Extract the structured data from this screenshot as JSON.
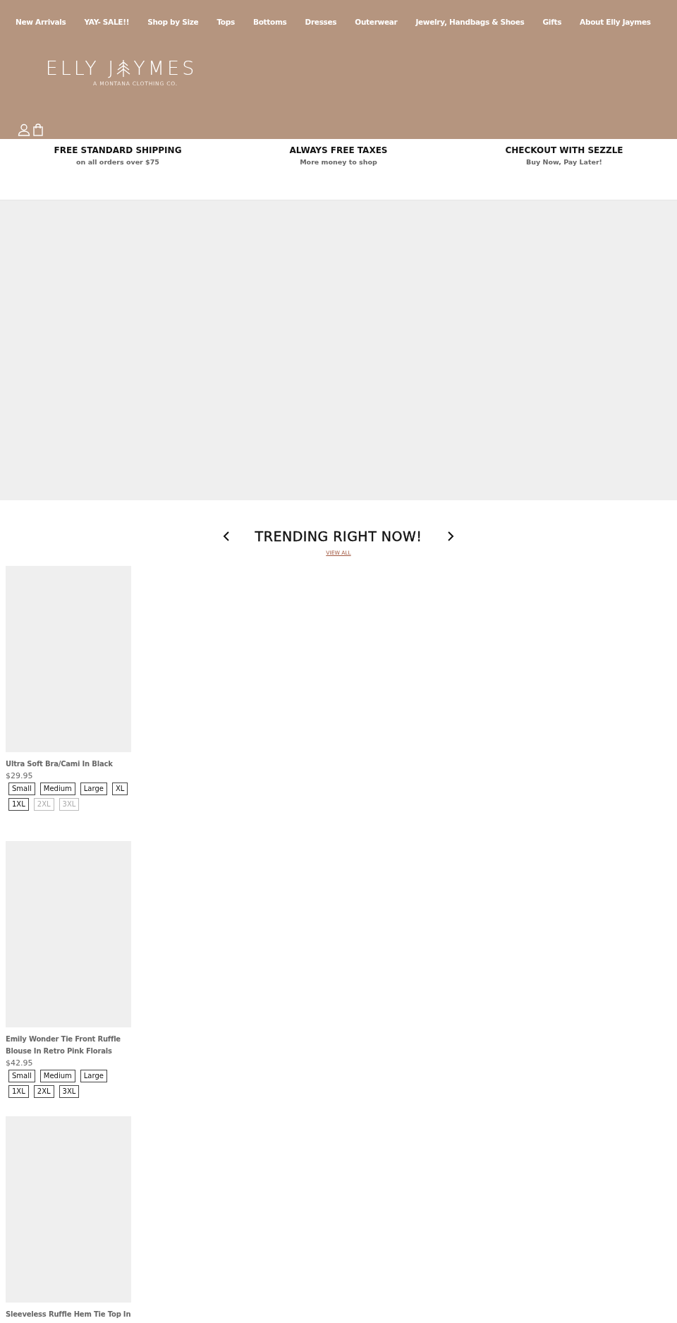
{
  "nav": [
    "New Arrivals",
    "YAY- SALE!!",
    "Shop by Size",
    "Tops",
    "Bottoms",
    "Dresses",
    "Outerwear",
    "Jewelry, Handbags & Shoes",
    "Gifts",
    "About Elly Jaymes"
  ],
  "logo": {
    "name_start": "ELLY J",
    "name_end": "YMES",
    "tagline": "A MONTANA CLOTHING CO."
  },
  "perks": [
    {
      "title": "FREE STANDARD SHIPPING",
      "subtitle": "on all orders over $75"
    },
    {
      "title": "ALWAYS FREE TAXES",
      "subtitle": "More money to shop"
    },
    {
      "title": "CHECKOUT WITH SEZZLE",
      "subtitle": "Buy Now, Pay Later!"
    }
  ],
  "trending": {
    "title": "TRENDING RIGHT NOW!",
    "link": "VIEW ALL"
  },
  "products": [
    {
      "title": "Ultra Soft Bra/Cami In Black",
      "price": "$29.95",
      "sizes": [
        {
          "label": "Small",
          "available": true
        },
        {
          "label": "Medium",
          "available": true
        },
        {
          "label": "Large",
          "available": true
        },
        {
          "label": "XL",
          "available": true
        },
        {
          "label": "1XL",
          "available": true
        },
        {
          "label": "2XL",
          "available": false
        },
        {
          "label": "3XL",
          "available": false
        }
      ]
    },
    {
      "title": "Emily Wonder Tie Front Ruffle Blouse In Retro Pink Florals",
      "price": "$42.95",
      "sizes": [
        {
          "label": "Small",
          "available": true
        },
        {
          "label": "Medium",
          "available": true
        },
        {
          "label": "Large",
          "available": true
        },
        {
          "label": "1XL",
          "available": true
        },
        {
          "label": "2XL",
          "available": true
        },
        {
          "label": "3XL",
          "available": true
        }
      ]
    },
    {
      "title": "Sleeveless Ruffle Hem Tie Top In"
    }
  ]
}
